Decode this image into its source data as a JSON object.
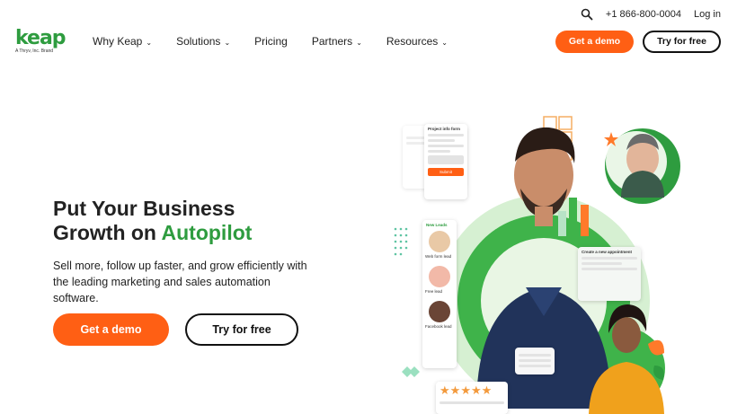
{
  "topbar": {
    "phone": "+1 866-800-0004",
    "login": "Log in",
    "icon": "search-icon"
  },
  "brand": {
    "name": "keap",
    "tagline": "A Thryv, Inc. Brand",
    "color": "#2e9c3f"
  },
  "nav": {
    "items": [
      {
        "label": "Why Keap",
        "dropdown": true
      },
      {
        "label": "Solutions",
        "dropdown": true
      },
      {
        "label": "Pricing",
        "dropdown": false
      },
      {
        "label": "Partners",
        "dropdown": true
      },
      {
        "label": "Resources",
        "dropdown": true
      }
    ],
    "demo_label": "Get a demo",
    "trial_label": "Try for free"
  },
  "hero": {
    "title_line1": "Put Your Business",
    "title_line2_prefix": "Growth on ",
    "title_line2_accent": "Autopilot",
    "subtitle": "Sell more, follow up faster, and grow efficiently with the leading marketing and sales automation software.",
    "demo_label": "Get a demo",
    "trial_label": "Try for free"
  },
  "illustration": {
    "form_title": "Project info form",
    "form_submit": "Submit",
    "new_leads": "New Leads",
    "lead_tags": [
      "Web form lead",
      "Free lead",
      "Facebook lead"
    ],
    "appointment_title": "Create a new appointment",
    "rating": 5
  },
  "colors": {
    "accent_orange": "#ff5f14",
    "brand_green": "#2e9c3f"
  }
}
